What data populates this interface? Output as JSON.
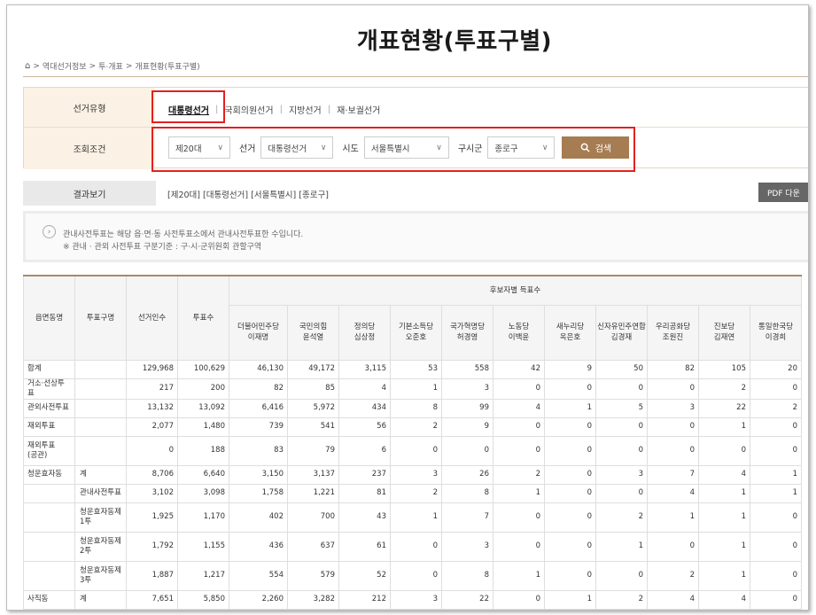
{
  "page": {
    "title": "개표현황(투표구별)",
    "breadcrumb": [
      "역대선거정보",
      "투·개표",
      "개표현황(투표구별)"
    ],
    "breadcrumb_separator": ">"
  },
  "filter": {
    "type_label": "선거유형",
    "tabs": [
      "대통령선거",
      "국회의원선거",
      "지방선거",
      "재·보궐선거"
    ],
    "active_tab": "대통령선거",
    "condition_label": "조회조건",
    "election_round": "제20대",
    "election_label": "선거",
    "election_value": "대통령선거",
    "province_label": "시도",
    "province_value": "서울특별시",
    "district_label": "구시군",
    "district_value": "종로구",
    "search_label": "검색"
  },
  "result": {
    "label": "결과보기",
    "summary": "[제20대] [대통령선거] [서울특별시] [종로구]",
    "pdf_label": "PDF 다운"
  },
  "notice": {
    "line1": "관내사전투표는 해당 읍·면·동 사전투표소에서 관내사전투표한 수입니다.",
    "line2": "※ 관내 · 관외 사전투표 구분기준 : 구·시·군위원회 관할구역"
  },
  "table": {
    "headers": {
      "district": "읍면동명",
      "vote_type": "투표구명",
      "electorate": "선거인수",
      "votes": "투표수",
      "candidate_group": "후보자별 득표수"
    },
    "candidates": [
      {
        "party": "더불어민주당",
        "name": "이재명"
      },
      {
        "party": "국민의힘",
        "name": "윤석열"
      },
      {
        "party": "정의당",
        "name": "심상정"
      },
      {
        "party": "기본소득당",
        "name": "오준호"
      },
      {
        "party": "국가혁명당",
        "name": "허경영"
      },
      {
        "party": "노동당",
        "name": "이백윤"
      },
      {
        "party": "새누리당",
        "name": "옥은호"
      },
      {
        "party": "신자유민주연합",
        "name": "김경재"
      },
      {
        "party": "우리공화당",
        "name": "조원진"
      },
      {
        "party": "진보당",
        "name": "김재연"
      },
      {
        "party": "통일한국당",
        "name": "이경희"
      }
    ],
    "rows": [
      {
        "district": "합계",
        "vote_type": "",
        "electorate": "129,968",
        "votes": "100,629",
        "counts": [
          "46,130",
          "49,172",
          "3,115",
          "53",
          "558",
          "42",
          "9",
          "50",
          "82",
          "105",
          "20"
        ]
      },
      {
        "district": "거소·선상투표",
        "vote_type": "",
        "electorate": "217",
        "votes": "200",
        "counts": [
          "82",
          "85",
          "4",
          "1",
          "3",
          "0",
          "0",
          "0",
          "0",
          "2",
          "0"
        ]
      },
      {
        "district": "관외사전투표",
        "vote_type": "",
        "electorate": "13,132",
        "votes": "13,092",
        "counts": [
          "6,416",
          "5,972",
          "434",
          "8",
          "99",
          "4",
          "1",
          "5",
          "3",
          "22",
          "2"
        ]
      },
      {
        "district": "재외투표",
        "vote_type": "",
        "electorate": "2,077",
        "votes": "1,480",
        "counts": [
          "739",
          "541",
          "56",
          "2",
          "9",
          "0",
          "0",
          "0",
          "0",
          "1",
          "0"
        ]
      },
      {
        "district": "재외투표\n(공관)",
        "vote_type": "",
        "electorate": "0",
        "votes": "188",
        "counts": [
          "83",
          "79",
          "6",
          "0",
          "0",
          "0",
          "0",
          "0",
          "0",
          "0",
          "0"
        ]
      },
      {
        "district": "청운효자동",
        "vote_type": "계",
        "electorate": "8,706",
        "votes": "6,640",
        "counts": [
          "3,150",
          "3,137",
          "237",
          "3",
          "26",
          "2",
          "0",
          "3",
          "7",
          "4",
          "1"
        ]
      },
      {
        "district": "",
        "vote_type": "관내사전투표",
        "electorate": "3,102",
        "votes": "3,098",
        "counts": [
          "1,758",
          "1,221",
          "81",
          "2",
          "8",
          "1",
          "0",
          "0",
          "4",
          "1",
          "1"
        ]
      },
      {
        "district": "",
        "vote_type": "청운효자동제\n1투",
        "electorate": "1,925",
        "votes": "1,170",
        "counts": [
          "402",
          "700",
          "43",
          "1",
          "7",
          "0",
          "0",
          "2",
          "1",
          "1",
          "0"
        ]
      },
      {
        "district": "",
        "vote_type": "청운효자동제\n2투",
        "electorate": "1,792",
        "votes": "1,155",
        "counts": [
          "436",
          "637",
          "61",
          "0",
          "3",
          "0",
          "0",
          "1",
          "0",
          "1",
          "0"
        ]
      },
      {
        "district": "",
        "vote_type": "청운효자동제\n3투",
        "electorate": "1,887",
        "votes": "1,217",
        "counts": [
          "554",
          "579",
          "52",
          "0",
          "8",
          "1",
          "0",
          "0",
          "2",
          "1",
          "0"
        ]
      },
      {
        "district": "사직동",
        "vote_type": "계",
        "electorate": "7,651",
        "votes": "5,850",
        "counts": [
          "2,260",
          "3,282",
          "212",
          "3",
          "22",
          "0",
          "1",
          "2",
          "4",
          "4",
          "0"
        ]
      }
    ]
  }
}
